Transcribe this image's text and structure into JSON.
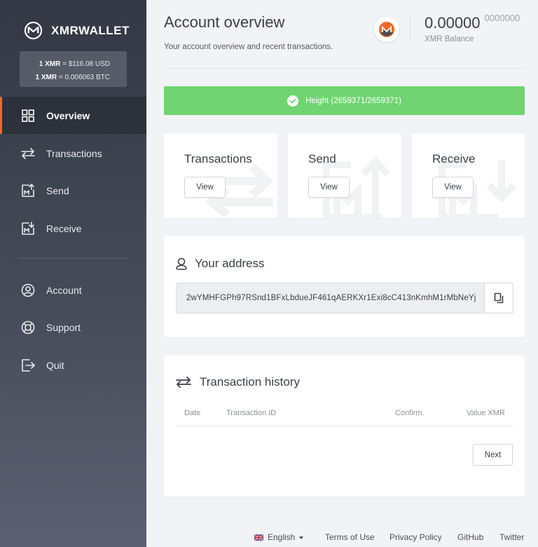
{
  "brand": {
    "name": "XMRWALLET",
    "logo_icon": "monero-m-logo-icon"
  },
  "rates": {
    "usd_label": "1 XMR",
    "usd_value": "$116.08 USD",
    "btc_label": "1 XMR",
    "btc_value": "0.006063 BTC"
  },
  "nav": {
    "primary": [
      {
        "label": "Overview",
        "icon": "grid-icon",
        "active": true
      },
      {
        "label": "Transactions",
        "icon": "swap-arrows-icon"
      },
      {
        "label": "Send",
        "icon": "send-chart-icon"
      },
      {
        "label": "Receive",
        "icon": "receive-chart-icon"
      }
    ],
    "secondary": [
      {
        "label": "Account",
        "icon": "user-circle-icon"
      },
      {
        "label": "Support",
        "icon": "lifebuoy-icon"
      },
      {
        "label": "Quit",
        "icon": "logout-icon"
      }
    ]
  },
  "header": {
    "title": "Account overview",
    "subtitle": "Your account overview and recent transactions.",
    "balance_int": "0.00000",
    "balance_dec": "0000000",
    "balance_label": "XMR Balance"
  },
  "status": {
    "text": "Height (2659371/2659371)",
    "color": "#6fd471"
  },
  "quick_cards": [
    {
      "title": "Transactions",
      "button": "View"
    },
    {
      "title": "Send",
      "button": "View"
    },
    {
      "title": "Receive",
      "button": "View"
    }
  ],
  "address": {
    "title": "Your address",
    "value": "2wYMHFGPh97RSnd1BFxLbdueJF461qAERKXr1Exi8cC413nKmhM1rMbNeYj"
  },
  "history": {
    "title": "Transaction history",
    "columns": [
      "Date",
      "Transaction ID",
      "Confirm.",
      "Value XMR"
    ],
    "next_label": "Next"
  },
  "footer": {
    "language": "English",
    "links": [
      "Terms of Use",
      "Privacy Policy",
      "GitHub",
      "Twitter"
    ]
  },
  "colors": {
    "accent": "#f26822",
    "sidebar": "#333844",
    "success": "#6fd471"
  }
}
